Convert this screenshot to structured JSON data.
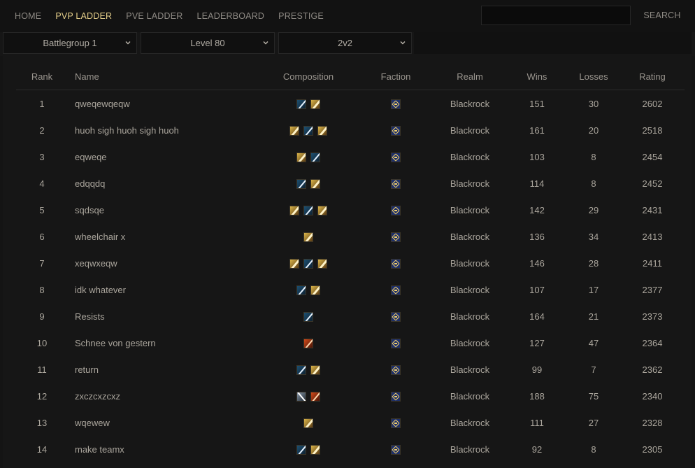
{
  "nav": {
    "items": [
      {
        "label": "HOME",
        "active": false
      },
      {
        "label": "PVP LADDER",
        "active": true
      },
      {
        "label": "PVE LADDER",
        "active": false
      },
      {
        "label": "LEADERBOARD",
        "active": false
      },
      {
        "label": "PRESTIGE",
        "active": false
      }
    ],
    "search_value": "",
    "search_button": "SEARCH"
  },
  "filters": {
    "battlegroup": "Battlegroup 1",
    "level": "Level 80",
    "bracket": "2v2"
  },
  "table": {
    "headers": {
      "rank": "Rank",
      "name": "Name",
      "composition": "Composition",
      "faction": "Faction",
      "realm": "Realm",
      "wins": "Wins",
      "losses": "Losses",
      "rating": "Rating"
    },
    "rows": [
      {
        "rank": "1",
        "name": "qweqewqeqw",
        "composition": [
          "warrior",
          "paladin"
        ],
        "faction": "alliance",
        "realm": "Blackrock",
        "wins": "151",
        "losses": "30",
        "rating": "2602"
      },
      {
        "rank": "2",
        "name": "huoh sigh huoh sigh huoh",
        "composition": [
          "paladin",
          "warrior",
          "paladin"
        ],
        "faction": "alliance",
        "realm": "Blackrock",
        "wins": "161",
        "losses": "20",
        "rating": "2518"
      },
      {
        "rank": "3",
        "name": "eqweqe",
        "composition": [
          "paladin",
          "warrior"
        ],
        "faction": "alliance",
        "realm": "Blackrock",
        "wins": "103",
        "losses": "8",
        "rating": "2454"
      },
      {
        "rank": "4",
        "name": "edqqdq",
        "composition": [
          "warrior",
          "paladin"
        ],
        "faction": "alliance",
        "realm": "Blackrock",
        "wins": "114",
        "losses": "8",
        "rating": "2452"
      },
      {
        "rank": "5",
        "name": "sqdsqe",
        "composition": [
          "paladin",
          "warrior",
          "paladin"
        ],
        "faction": "alliance",
        "realm": "Blackrock",
        "wins": "142",
        "losses": "29",
        "rating": "2431"
      },
      {
        "rank": "6",
        "name": "wheelchair x",
        "composition": [
          "paladin"
        ],
        "faction": "alliance",
        "realm": "Blackrock",
        "wins": "136",
        "losses": "34",
        "rating": "2413"
      },
      {
        "rank": "7",
        "name": "xeqwxeqw",
        "composition": [
          "paladin",
          "warrior",
          "paladin"
        ],
        "faction": "alliance",
        "realm": "Blackrock",
        "wins": "146",
        "losses": "28",
        "rating": "2411"
      },
      {
        "rank": "8",
        "name": "idk whatever",
        "composition": [
          "warrior",
          "paladin"
        ],
        "faction": "alliance",
        "realm": "Blackrock",
        "wins": "107",
        "losses": "17",
        "rating": "2377"
      },
      {
        "rank": "9",
        "name": "Resists",
        "composition": [
          "warrior"
        ],
        "faction": "alliance",
        "realm": "Blackrock",
        "wins": "164",
        "losses": "21",
        "rating": "2373"
      },
      {
        "rank": "10",
        "name": "Schnee von gestern",
        "composition": [
          "rogue"
        ],
        "faction": "alliance",
        "realm": "Blackrock",
        "wins": "127",
        "losses": "47",
        "rating": "2364"
      },
      {
        "rank": "11",
        "name": "return",
        "composition": [
          "warrior",
          "paladin"
        ],
        "faction": "alliance",
        "realm": "Blackrock",
        "wins": "99",
        "losses": "7",
        "rating": "2362"
      },
      {
        "rank": "12",
        "name": "zxczcxzcxz",
        "composition": [
          "hunter",
          "rogue"
        ],
        "faction": "alliance",
        "realm": "Blackrock",
        "wins": "188",
        "losses": "75",
        "rating": "2340"
      },
      {
        "rank": "13",
        "name": "wqewew",
        "composition": [
          "paladin"
        ],
        "faction": "alliance",
        "realm": "Blackrock",
        "wins": "111",
        "losses": "27",
        "rating": "2328"
      },
      {
        "rank": "14",
        "name": "make teamx",
        "composition": [
          "warrior",
          "paladin"
        ],
        "faction": "alliance",
        "realm": "Blackrock",
        "wins": "92",
        "losses": "8",
        "rating": "2305"
      }
    ]
  },
  "icons": {
    "select_chevron": "chevron-down-icon",
    "faction": "alliance-icon",
    "class_icons": {
      "warrior": "warrior-class-icon",
      "paladin": "paladin-class-icon",
      "rogue": "rogue-class-icon",
      "hunter": "hunter-class-icon"
    }
  },
  "colors": {
    "active_nav": "#e5cf8a",
    "background": "#141414",
    "panel": "#161616",
    "text": "#aaa59c"
  }
}
